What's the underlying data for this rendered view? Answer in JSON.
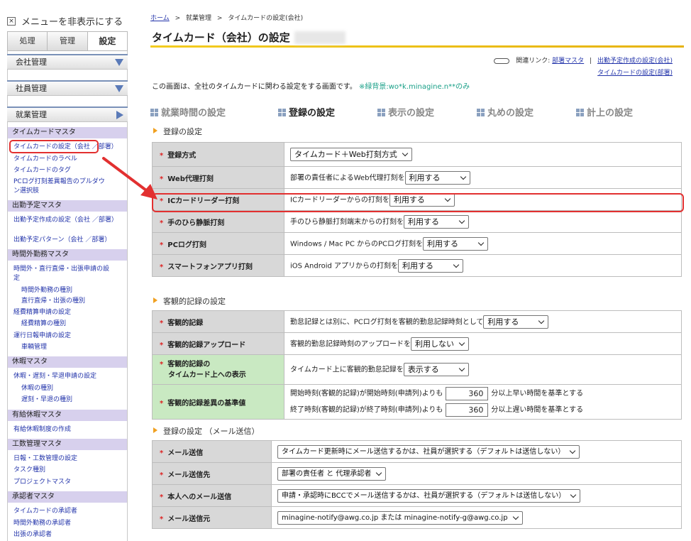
{
  "sidebar": {
    "toggle_label": "メニューを非表示にする",
    "tabs": [
      "処理",
      "管理",
      "設定"
    ],
    "sections": [
      {
        "label": "会社管理"
      },
      {
        "label": "社員管理"
      },
      {
        "label": "就業管理"
      }
    ],
    "groups": {
      "timecard": "タイムカードマスタ",
      "schedule": "出勤予定マスタ",
      "overtime": "時間外勤務マスタ",
      "leave": "休暇マスタ",
      "paid": "有給休暇マスタ",
      "workload": "工数管理マスタ",
      "approver": "承認者マスタ"
    },
    "links": {
      "timecard_setting": "タイムカードの設定（会社 ／部署）",
      "timecard_label": "タイムカードのラベル",
      "timecard_tag": "タイムカードのタグ",
      "pclog_pulldown_1": "PCログ打刻差異報告のプルダウ",
      "pclog_pulldown_2": "ン選択肢",
      "schedule_setting": "出勤予定作成の設定（会社 ／部署）",
      "schedule_pattern": "出勤予定パターン（会社 ／部署）",
      "overtime_setting_1": "時間外・直行直帰・出張申請の設",
      "overtime_setting_2": "定",
      "overtime_type": "時間外勤務の種別",
      "direct_type": "直行直帰・出張の種別",
      "expense_setting": "経費精算申請の設定",
      "expense_type": "経費精算の種別",
      "drive_setting": "運行日報申請の設定",
      "vehicle": "車輌管理",
      "leave_setting": "休暇・遅刻・早退申請の設定",
      "leave_type": "休暇の種別",
      "late_type": "遅刻・早退の種別",
      "paid_system": "有給休暇制度の作成",
      "daily_setting": "日報・工数管理の設定",
      "task_type": "タスク種別",
      "project_master": "プロジェクトマスタ",
      "tc_approver": "タイムカードの承認者",
      "ot_approver": "時間外勤務の承認者",
      "trip_approver": "出張の承認者"
    }
  },
  "breadcrumb": {
    "home": "ホーム",
    "sep1": ">",
    "mid": "就業管理",
    "sep2": ">",
    "current": "タイムカードの設定(会社)"
  },
  "page_title": "タイムカード（会社）の設定",
  "related": {
    "label": "関連リンク:",
    "link1": "部署マスタ",
    "divider": "|",
    "link2": "出勤予定作成の設定(会社)",
    "link3": "タイムカードの設定(部署)"
  },
  "intro": {
    "text": "この画面は、全社のタイムカードに関わる設定をする画面です。",
    "note": "※緑背景:wo*k.minagine.n**のみ"
  },
  "section_tabs": [
    "就業時間の設定",
    "登録の設定",
    "表示の設定",
    "丸めの設定",
    "計上の設定"
  ],
  "sections": {
    "reg": "登録の設定",
    "obj": "客観的記録の設定",
    "mail": "登録の設定 （メール送信）"
  },
  "required_mark": "*",
  "reg_rows": [
    {
      "label": "登録方式",
      "text": "",
      "select": "タイムカード＋Web打刻方式"
    },
    {
      "label": "Web代理打刻",
      "text": "部署の責任者によるWeb代理打刻を",
      "select": "利用する"
    },
    {
      "label": "ICカードリーダー打刻",
      "text": "ICカードリーダーからの打刻を",
      "select": "利用する"
    },
    {
      "label": "手のひら静脈打刻",
      "text": "手のひら静脈打刻端末からの打刻を",
      "select": "利用する"
    },
    {
      "label": "PCログ打刻",
      "text": "Windows / Mac PC からのPCログ打刻を",
      "select": "利用する"
    },
    {
      "label": "スマートフォンアプリ打刻",
      "text": "iOS Android アプリからの打刻を",
      "select": "利用する"
    }
  ],
  "obj_rows": [
    {
      "label": "客観的記録",
      "text": "勤怠記録とは別に、PCログ打刻を客観的勤怠記録時刻として",
      "select": "利用する"
    },
    {
      "label": "客観的記録アップロード",
      "text": "客観的勤怠記録時刻のアップロードを",
      "select": "利用しない"
    },
    {
      "label1": "客観的記録の",
      "label2": "タイムカード上への表示",
      "text": "タイムカード上に客観的勤怠記録を",
      "select": "表示する"
    },
    {
      "label": "客観的記録差異の基準値",
      "line1_pre": "開始時刻(客観的記録)が開始時刻(申請列)よりも",
      "line1_val": "360",
      "line1_post": "分以上早い時間を基準とする",
      "line2_pre": "終了時刻(客観的記録)が終了時刻(申請列)よりも",
      "line2_val": "360",
      "line2_post": "分以上遅い時間を基準とする"
    }
  ],
  "mail_rows": [
    {
      "label": "メール送信",
      "select": "タイムカード更新時にメール送信するかは、社員が選択する（デフォルトは送信しない）"
    },
    {
      "label": "メール送信先",
      "select": "部署の責任者 と 代理承認者"
    },
    {
      "label": "本人へのメール送信",
      "select": "申請・承認時にBCCでメール送信するかは、社員が選択する（デフォルトは送信しない）"
    },
    {
      "label": "メール送信元",
      "select": "minagine-notify@awg.co.jp または minagine-notify-g@awg.co.jp"
    }
  ],
  "colors": {
    "accent_yellow": "#f3cc20",
    "highlight_red": "#e23030",
    "label_gray": "#d8d8d8",
    "label_green": "#c9e9c2",
    "group_purple": "#d7d0ed"
  }
}
